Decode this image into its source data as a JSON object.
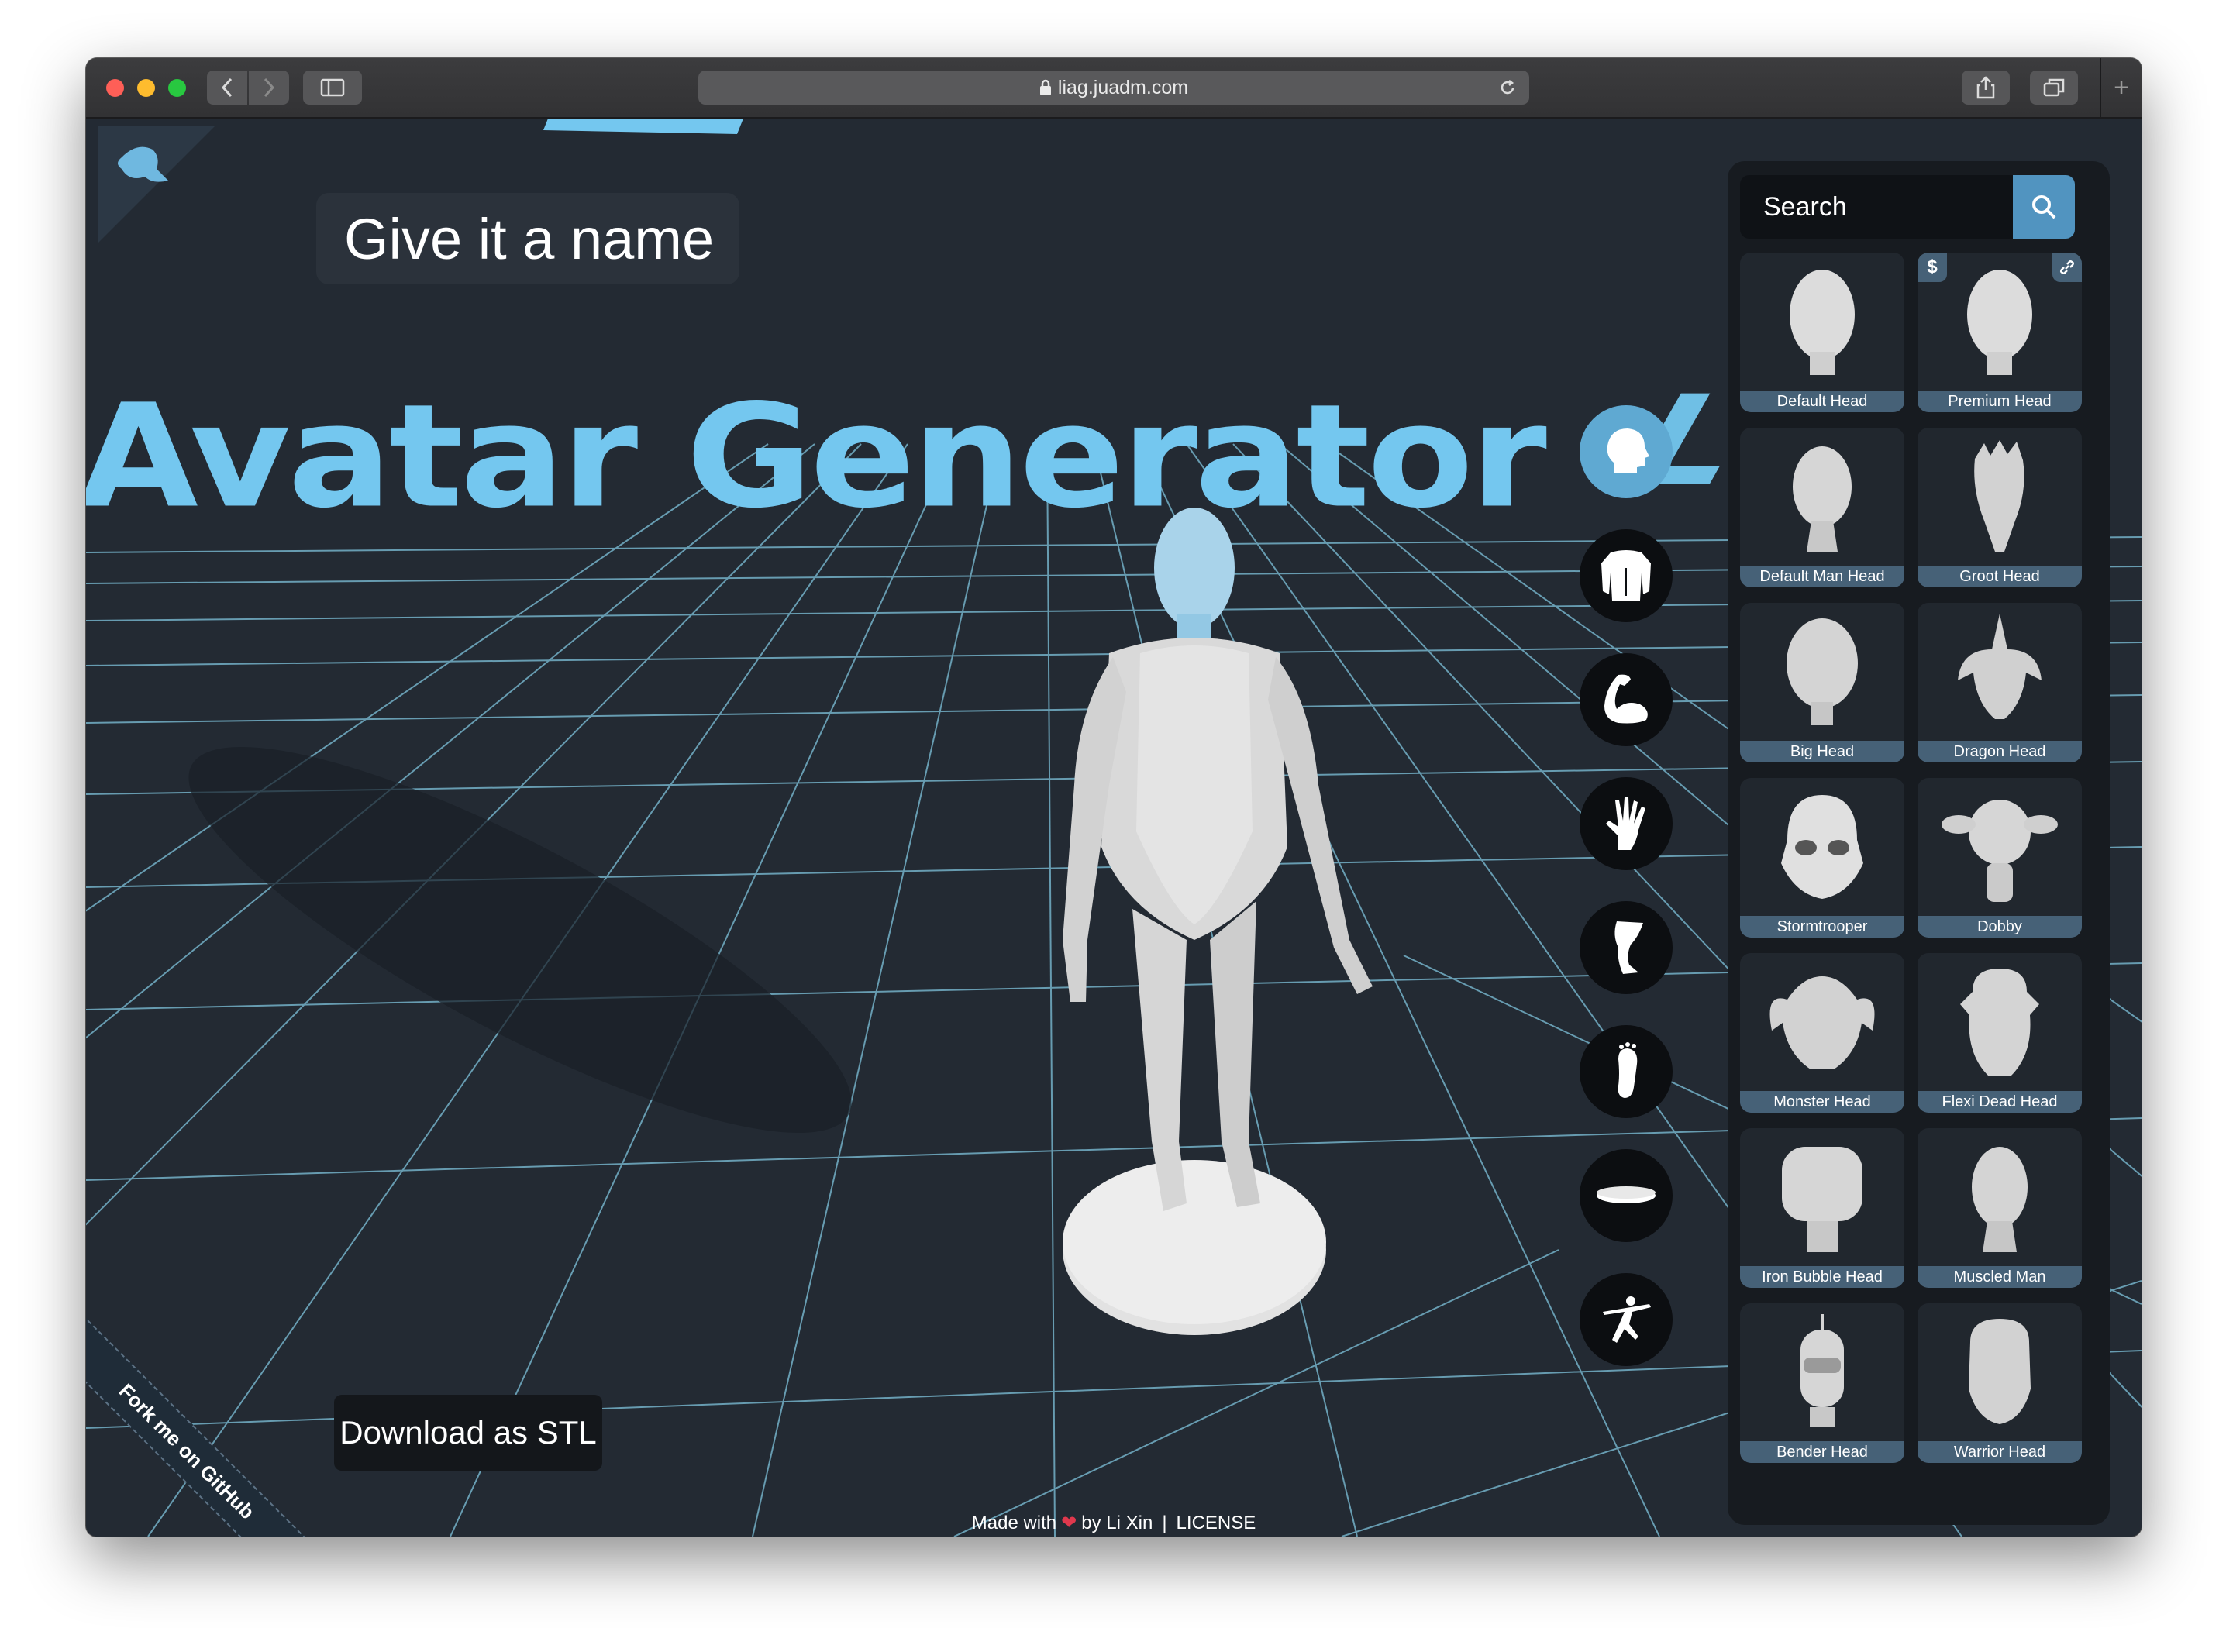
{
  "browser": {
    "url": "liag.juadm.com"
  },
  "scene": {
    "title_text": "Avatar Generator",
    "title_partial": "Av",
    "title_rest": "atar Generator",
    "backdrop_text": "LiXin"
  },
  "name_field": {
    "placeholder": "Give it a name"
  },
  "download_button": {
    "label": "Download as STL"
  },
  "ribbon": {
    "label": "Fork me on GitHub"
  },
  "footer": {
    "made_with": "Made with",
    "by": "by Li Xin",
    "separator": "|",
    "license": "LICENSE"
  },
  "categories": [
    {
      "name": "head",
      "icon": "head-icon",
      "active": true
    },
    {
      "name": "torso",
      "icon": "torso-icon",
      "active": false
    },
    {
      "name": "arm",
      "icon": "arm-icon",
      "active": false
    },
    {
      "name": "hand",
      "icon": "hand-icon",
      "active": false
    },
    {
      "name": "leg",
      "icon": "leg-icon",
      "active": false
    },
    {
      "name": "foot",
      "icon": "foot-icon",
      "active": false
    },
    {
      "name": "stand",
      "icon": "stand-icon",
      "active": false
    },
    {
      "name": "pose",
      "icon": "pose-icon",
      "active": false
    }
  ],
  "search": {
    "placeholder": "Search"
  },
  "items": [
    {
      "label": "Default Head",
      "badges": []
    },
    {
      "label": "Premium Head",
      "badges": [
        "$",
        "link"
      ]
    },
    {
      "label": "Default Man Head",
      "badges": []
    },
    {
      "label": "Groot Head",
      "badges": []
    },
    {
      "label": "Big Head",
      "badges": []
    },
    {
      "label": "Dragon Head",
      "badges": []
    },
    {
      "label": "Stormtrooper",
      "badges": []
    },
    {
      "label": "Dobby",
      "badges": []
    },
    {
      "label": "Monster Head",
      "badges": []
    },
    {
      "label": "Flexi Dead Head",
      "badges": []
    },
    {
      "label": "Iron Bubble Head",
      "badges": []
    },
    {
      "label": "Muscled Man",
      "badges": []
    },
    {
      "label": "Bender Head",
      "badges": []
    },
    {
      "label": "Warrior Head",
      "badges": []
    }
  ],
  "colors": {
    "accent": "#74c7ef",
    "active_icon": "#5fa9d2",
    "label_bar": "#466177",
    "grid_line": "#7ec3dc",
    "scene_bg": "#232a33"
  }
}
